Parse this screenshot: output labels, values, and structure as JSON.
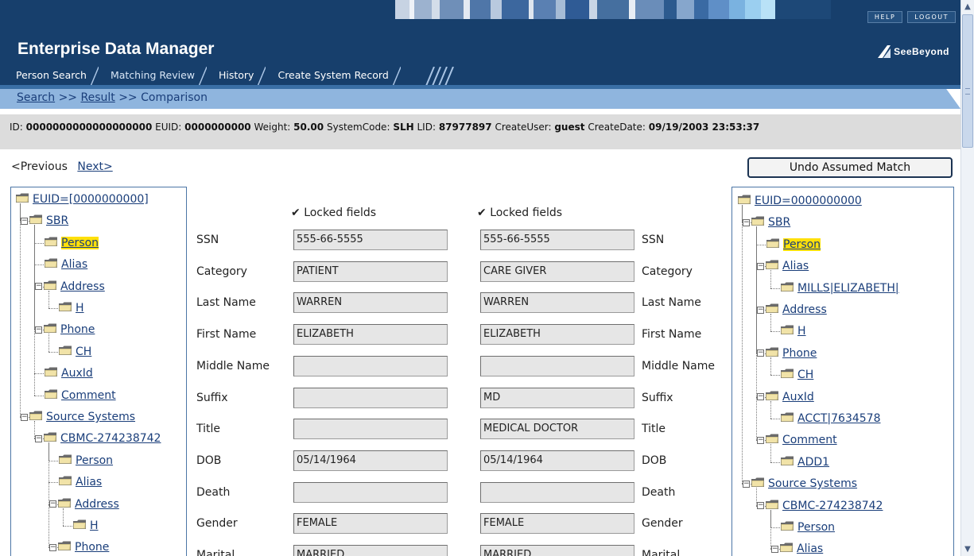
{
  "header": {
    "app_title": "Enterprise Data Manager",
    "help": "HELP",
    "logout": "LOGOUT",
    "brand": "SeeBeyond",
    "tabs": [
      {
        "label": "Person Search",
        "active": false
      },
      {
        "label": "Matching Review",
        "active": true
      },
      {
        "label": "History",
        "active": false
      },
      {
        "label": "Create System Record",
        "active": false
      }
    ]
  },
  "breadcrumb": {
    "search": "Search",
    "sep": ">>",
    "result": "Result",
    "current": "Comparison"
  },
  "info": {
    "id_label": "ID:",
    "id_value": "0000000000000000000",
    "euid_label": "EUID:",
    "euid_value": "0000000000",
    "weight_label": "Weight:",
    "weight_value": "50.00",
    "systemcode_label": "SystemCode:",
    "systemcode_value": "SLH",
    "lid_label": "LID:",
    "lid_value": "87977897",
    "createuser_label": "CreateUser:",
    "createuser_value": "guest",
    "createdate_label": "CreateDate:",
    "createdate_value": "09/19/2003 23:53:37"
  },
  "nav": {
    "previous": "<Previous",
    "next": "Next>"
  },
  "undo_button": "Undo Assumed Match",
  "tree_left": [
    {
      "label": "EUID=[0000000000]",
      "expander": false
    },
    {
      "label": "SBR",
      "expander": true
    },
    {
      "label": "Person",
      "expander": false,
      "selected": true
    },
    {
      "label": "Alias",
      "expander": false
    },
    {
      "label": "Address",
      "expander": true
    },
    {
      "label": "H",
      "expander": false
    },
    {
      "label": "Phone",
      "expander": true
    },
    {
      "label": "CH",
      "expander": false
    },
    {
      "label": "AuxId",
      "expander": false
    },
    {
      "label": "Comment",
      "expander": false
    },
    {
      "label": "Source Systems",
      "expander": true
    },
    {
      "label": "CBMC-274238742",
      "expander": true
    },
    {
      "label": "Person",
      "expander": false
    },
    {
      "label": "Alias",
      "expander": false
    },
    {
      "label": "Address",
      "expander": true
    },
    {
      "label": "H",
      "expander": false
    },
    {
      "label": "Phone",
      "expander": true
    }
  ],
  "tree_right": [
    {
      "label": "EUID=0000000000",
      "expander": false
    },
    {
      "label": "SBR",
      "expander": true
    },
    {
      "label": "Person",
      "expander": false,
      "selected": true
    },
    {
      "label": "Alias",
      "expander": true
    },
    {
      "label": "MILLS|ELIZABETH|",
      "expander": false
    },
    {
      "label": "Address",
      "expander": true
    },
    {
      "label": "H",
      "expander": false
    },
    {
      "label": "Phone",
      "expander": true
    },
    {
      "label": "CH",
      "expander": false
    },
    {
      "label": "AuxId",
      "expander": true
    },
    {
      "label": "ACCT|7634578",
      "expander": false
    },
    {
      "label": "Comment",
      "expander": true
    },
    {
      "label": "ADD1",
      "expander": false
    },
    {
      "label": "Source Systems",
      "expander": true
    },
    {
      "label": "CBMC-274238742",
      "expander": true
    },
    {
      "label": "Person",
      "expander": false
    },
    {
      "label": "Alias",
      "expander": true
    }
  ],
  "comparison": {
    "locked_label": "Locked fields",
    "rows": [
      {
        "label": "SSN",
        "left": "555-66-5555",
        "right": "555-66-5555"
      },
      {
        "label": "Category",
        "left": "PATIENT",
        "right": "CARE GIVER"
      },
      {
        "label": "Last Name",
        "left": "WARREN",
        "right": "WARREN"
      },
      {
        "label": "First Name",
        "left": "ELIZABETH",
        "right": "ELIZABETH"
      },
      {
        "label": "Middle Name",
        "left": "",
        "right": ""
      },
      {
        "label": "Suffix",
        "left": "",
        "right": "MD"
      },
      {
        "label": "Title",
        "left": "",
        "right": "MEDICAL DOCTOR"
      },
      {
        "label": "DOB",
        "left": "05/14/1964",
        "right": "05/14/1964"
      },
      {
        "label": "Death",
        "left": "",
        "right": ""
      },
      {
        "label": "Gender",
        "left": "FEMALE",
        "right": "FEMALE"
      },
      {
        "label": "Marital",
        "left": "MARRIED",
        "right": "MARRIED"
      }
    ]
  },
  "colors": {
    "header_bg": "#173f6c",
    "crumb_bg": "#8fb5de",
    "selected_node": "#ffe00a",
    "link": "#1a3e7a"
  }
}
